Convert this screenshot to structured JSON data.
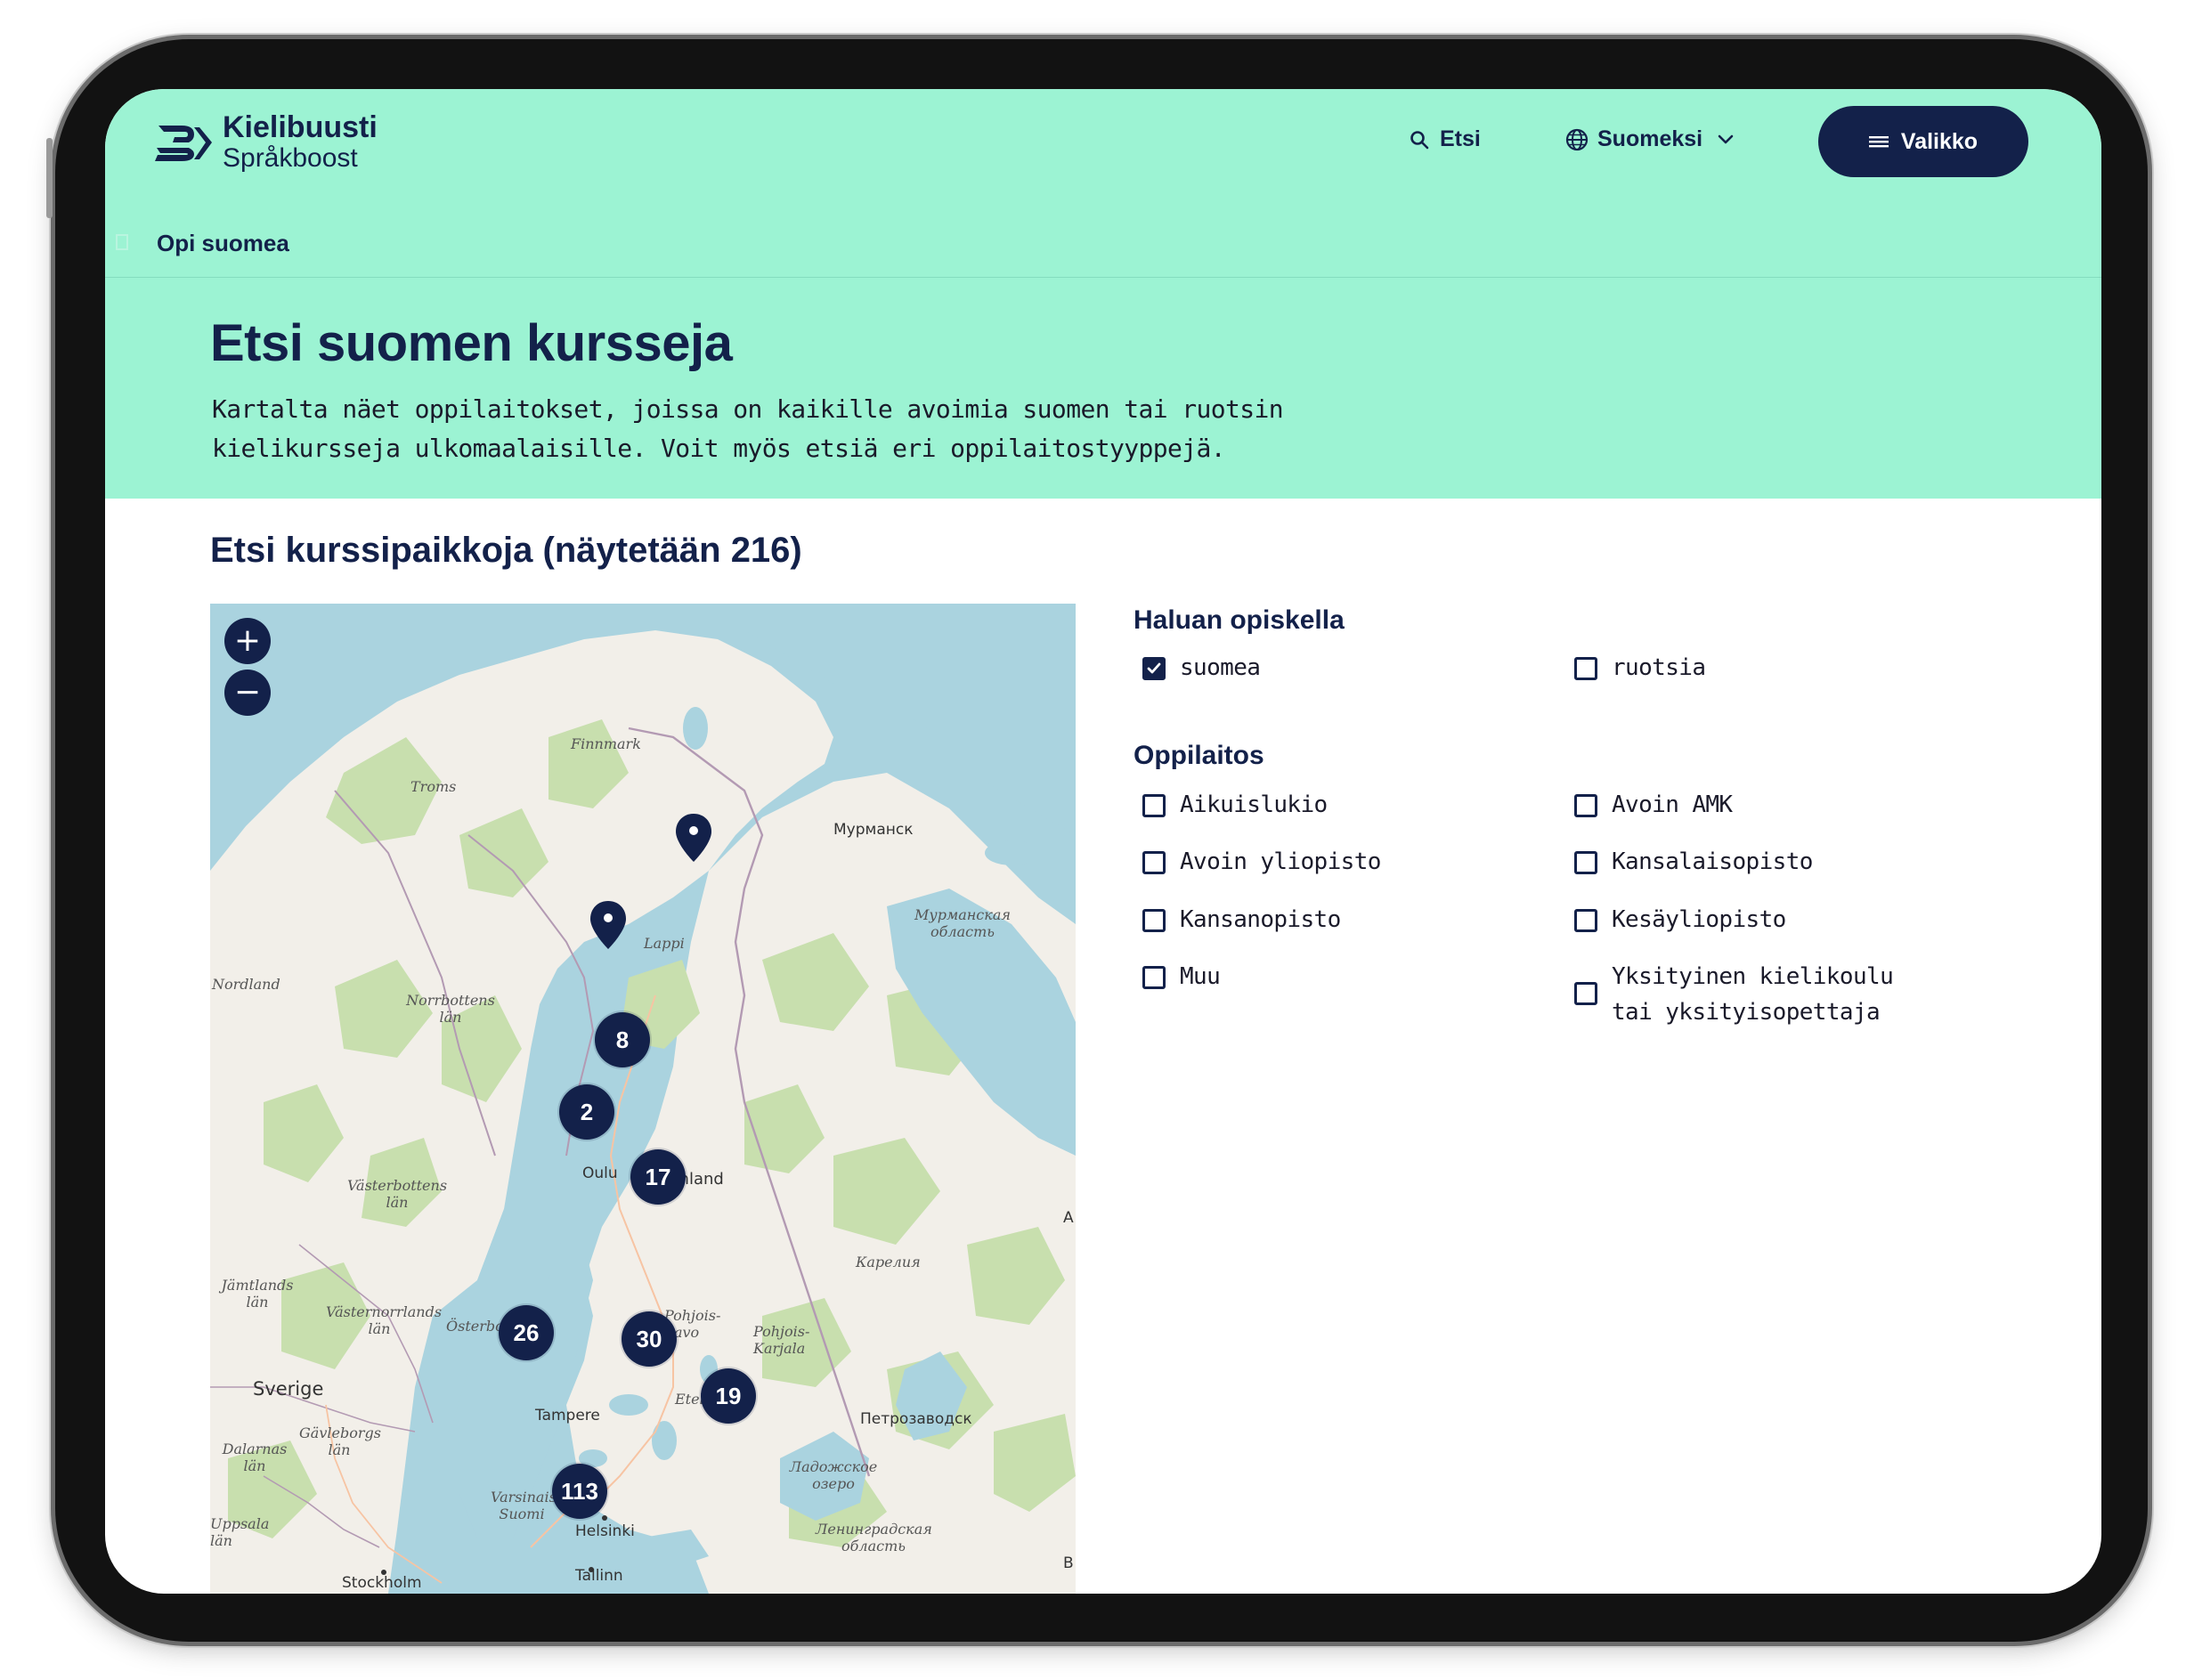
{
  "brand": {
    "name": "Kielibuusti",
    "subname": "Språkboost"
  },
  "nav": {
    "search_label": "Etsi",
    "language_label": "Suomeksi",
    "menu_label": "Valikko"
  },
  "breadcrumb": {
    "label": "Opi suomea"
  },
  "hero": {
    "title": "Etsi suomen kursseja",
    "intro": "Kartalta näet oppilaitokset, joissa on kaikille avoimia suomen tai ruotsin kielikursseja ulkomaalaisille. Voit myös etsiä eri oppilaitostyyppejä."
  },
  "section": {
    "title": "Etsi kurssipaikkoja (näytetään 216)"
  },
  "map": {
    "zoom_in": "+",
    "zoom_out": "−",
    "clusters": [
      "8",
      "2",
      "17",
      "26",
      "30",
      "19",
      "113"
    ],
    "labels": {
      "finnmark": "Finnmark",
      "troms": "Troms",
      "murmansk": "Мурманск",
      "murmansk_oblast": "Мурманская область",
      "lappi": "Lappi",
      "nordland": "Nordland",
      "norrbotten": "Norrbottens län",
      "vasterbotten": "Västerbottens län",
      "oulu": "Oulu",
      "finland": "i / Finland",
      "karelia": "Карелия",
      "jamtland": "Jämtlands län",
      "vasternorrland": "Västernorrlands län",
      "osterbotten": "Österbo",
      "pohjois_savo": "Pohjois-Savo",
      "pohjois_karjala": "Pohjois-Karjala",
      "sverige": "Sverige",
      "tampere": "Tampere",
      "etela": "Etelä",
      "petrozavodsk": "Петрозаводск",
      "dalarnas": "Dalarnas län",
      "gavleborgs": "Gävleborgs län",
      "varsinais": "Varsinais-Suomi",
      "ladoga": "Ладожское озеро",
      "leningrad": "Ленинградская область",
      "helsinki": "Helsinki",
      "uppsala": "Uppsala län",
      "stockholm": "Stockholm",
      "tallinn": "Tallinn",
      "edge_a": "A",
      "edge_b": "B"
    }
  },
  "filters": {
    "language": {
      "title": "Haluan opiskella",
      "options": [
        {
          "label": "suomea",
          "checked": true
        },
        {
          "label": "ruotsia",
          "checked": false
        }
      ]
    },
    "institution": {
      "title": "Oppilaitos",
      "options": [
        {
          "label": "Aikuislukio",
          "checked": false
        },
        {
          "label": "Avoin AMK",
          "checked": false
        },
        {
          "label": "Avoin yliopisto",
          "checked": false
        },
        {
          "label": "Kansalaisopisto",
          "checked": false
        },
        {
          "label": "Kansanopisto",
          "checked": false
        },
        {
          "label": "Kesäyliopisto",
          "checked": false
        },
        {
          "label": "Muu",
          "checked": false
        },
        {
          "label": "Yksityinen kielikoulu tai yksityisopettaja",
          "checked": false
        }
      ]
    }
  },
  "colors": {
    "brand_navy": "#13214a",
    "header_mint": "#9cf3d3",
    "sea": "#aad3df",
    "land": "#f2efe9",
    "forest": "#c8dfae"
  }
}
